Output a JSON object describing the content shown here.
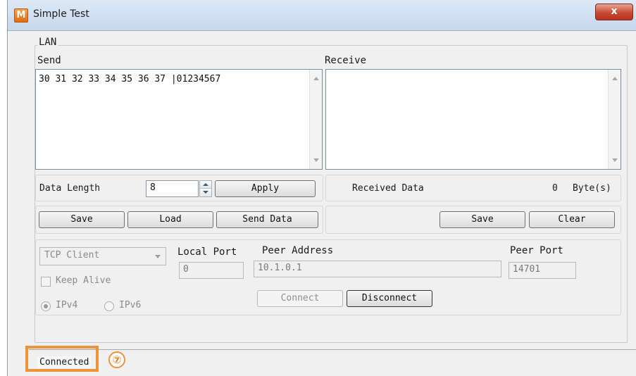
{
  "window": {
    "app_icon_letter": "M",
    "title": "Simple Test",
    "close_label": "x"
  },
  "lan": {
    "group_label": "LAN",
    "send": {
      "label": "Send",
      "content": "30 31 32 33 34 35 36 37 |01234567"
    },
    "receive": {
      "label": "Receive",
      "content": ""
    },
    "data_length": {
      "label": "Data Length",
      "value": "8",
      "apply_label": "Apply"
    },
    "received_data": {
      "label": "Received Data",
      "count": "0",
      "unit": "Byte(s)"
    },
    "send_buttons": {
      "save": "Save",
      "load": "Load",
      "send_data": "Send Data"
    },
    "receive_buttons": {
      "save": "Save",
      "clear": "Clear"
    }
  },
  "connection": {
    "mode": "TCP Client",
    "keep_alive_label": "Keep Alive",
    "ipv4_label": "IPv4",
    "ipv6_label": "IPv6",
    "local_port_label": "Local Port",
    "local_port_value": "0",
    "peer_address_label": "Peer Address",
    "peer_address_value": "10.1.0.1",
    "peer_port_label": "Peer Port",
    "peer_port_value": "14701",
    "connect_label": "Connect",
    "disconnect_label": "Disconnect"
  },
  "status": {
    "text": "Connected"
  },
  "annotation": {
    "marker": "⑦",
    "color": "#f0923a"
  }
}
